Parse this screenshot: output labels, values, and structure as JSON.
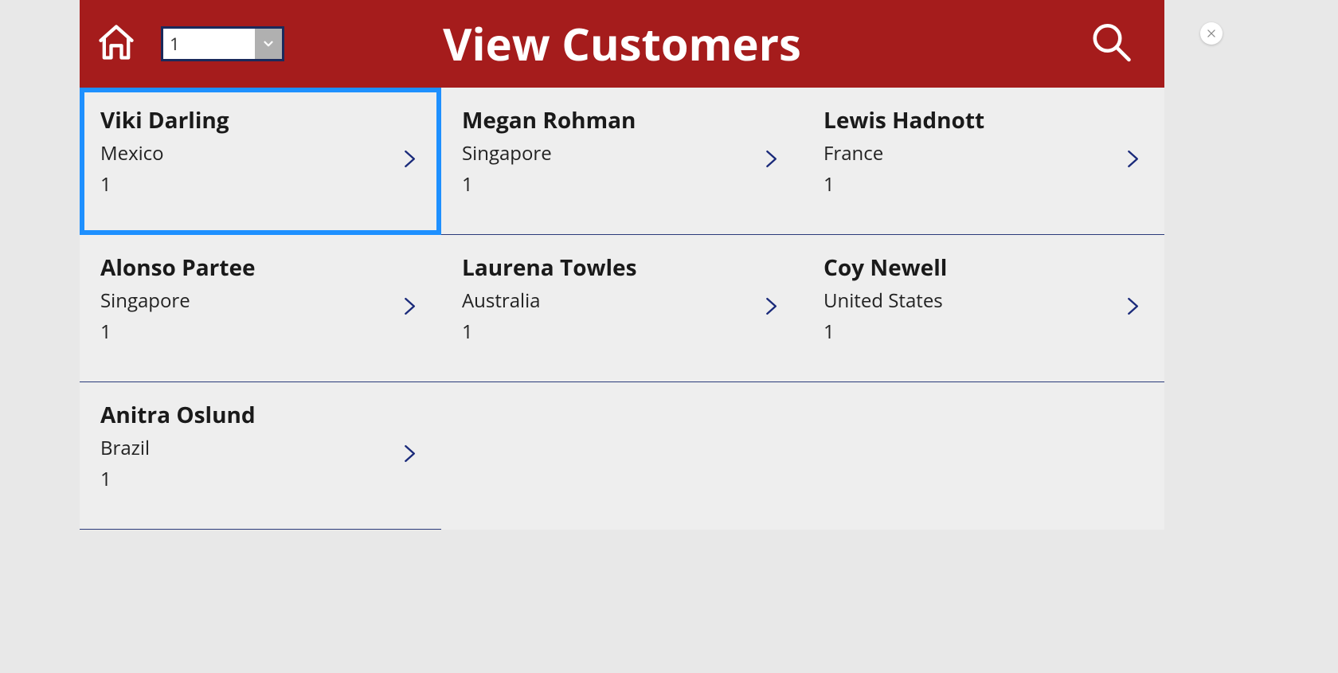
{
  "header": {
    "title": "View Customers",
    "dropdown_value": "1"
  },
  "customers": [
    {
      "name": "Viki  Darling",
      "country": "Mexico",
      "num": "1",
      "selected": true
    },
    {
      "name": "Megan  Rohman",
      "country": "Singapore",
      "num": "1",
      "selected": false
    },
    {
      "name": "Lewis  Hadnott",
      "country": "France",
      "num": "1",
      "selected": false
    },
    {
      "name": "Alonso  Partee",
      "country": "Singapore",
      "num": "1",
      "selected": false
    },
    {
      "name": "Laurena  Towles",
      "country": "Australia",
      "num": "1",
      "selected": false
    },
    {
      "name": "Coy  Newell",
      "country": "United States",
      "num": "1",
      "selected": false
    },
    {
      "name": "Anitra  Oslund",
      "country": "Brazil",
      "num": "1",
      "selected": false
    }
  ]
}
